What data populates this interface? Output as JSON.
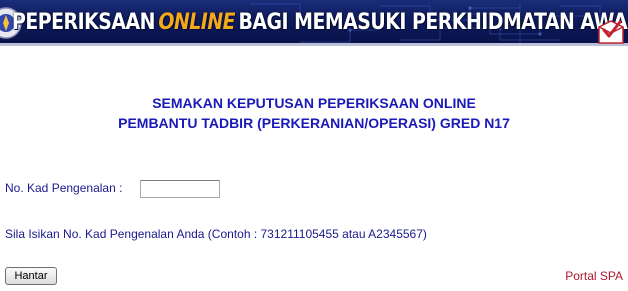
{
  "banner": {
    "title_part1": "PEPERIKSAAN",
    "title_highlight": "ONLINE",
    "title_part2": "BAGI MEMASUKI PERKHIDMATAN AWAM",
    "logo_icon": "agency-emblem-icon",
    "ballot_icon": "ballot-box-checkmark-icon"
  },
  "heading": {
    "line1": "SEMAKAN KEPUTUSAN PEPERIKSAAN ONLINE",
    "line2": "PEMBANTU TADBIR (PERKERANIAN/OPERASI) GRED N17"
  },
  "form": {
    "ic_label": "No. Kad Pengenalan :",
    "ic_value": "",
    "hint": "Sila Isikan No. Kad Pengenalan Anda (Contoh : 731211105455 atau A2345567)",
    "submit_label": "Hantar"
  },
  "footer": {
    "portal_link": "Portal SPA"
  },
  "colors": {
    "banner_bg": "#0d1a5c",
    "banner_highlight": "#f4a81c",
    "heading": "#1a1ab8",
    "body_text": "#1a1a8c",
    "link": "#b0162c"
  }
}
